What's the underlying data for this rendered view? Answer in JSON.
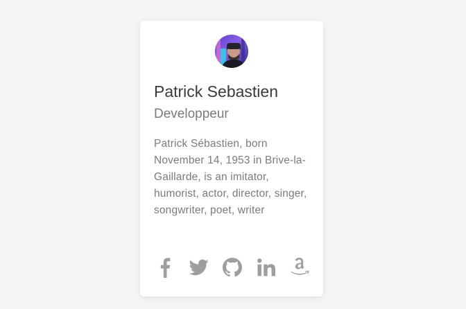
{
  "profile": {
    "name": "Patrick Sebastien",
    "role": "Developpeur",
    "bio": "Patrick Sébastien, born November 14, 1953 in Brive-la-Gaillarde, is an imitator, humorist, actor, director, singer, songwriter, poet, writer"
  },
  "socials": [
    {
      "icon": "facebook-icon"
    },
    {
      "icon": "twitter-icon"
    },
    {
      "icon": "github-icon"
    },
    {
      "icon": "linkedin-icon"
    },
    {
      "icon": "amazon-icon"
    }
  ],
  "colors": {
    "background": "#f5f5f5",
    "card": "#ffffff",
    "name_text": "#3a3a3a",
    "secondary_text": "#7b7b7b",
    "icon": "#9e9e9e"
  }
}
